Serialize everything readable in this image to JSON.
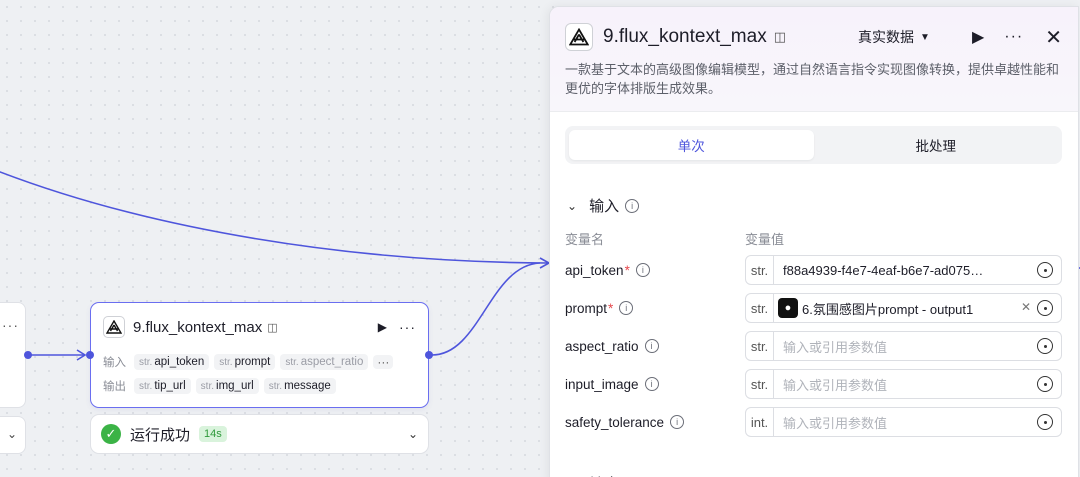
{
  "node": {
    "title": "9.flux_kontext_max",
    "input_label": "输入",
    "output_label": "输出",
    "inputs": [
      {
        "type": "str.",
        "name": "api_token"
      },
      {
        "type": "str.",
        "name": "prompt"
      },
      {
        "type": "str.",
        "name": "aspect_ratio"
      }
    ],
    "outputs": [
      {
        "type": "str.",
        "name": "tip_url"
      },
      {
        "type": "str.",
        "name": "img_url"
      },
      {
        "type": "str.",
        "name": "message"
      }
    ]
  },
  "status": {
    "text": "运行成功",
    "time": "14s"
  },
  "panel": {
    "title": "9.flux_kontext_max",
    "data_mode": "真实数据",
    "description": "一款基于文本的高级图像编辑模型，通过自然语言指令实现图像转换，提供卓越性能和更优的字体排版生成效果。",
    "tabs": [
      {
        "label": "单次",
        "active": true
      },
      {
        "label": "批处理",
        "active": false
      }
    ],
    "input_section": "输入",
    "col_name": "变量名",
    "col_value": "变量值",
    "params": [
      {
        "name": "api_token",
        "required": true,
        "type": "str.",
        "value": "f88a4939-f4e7-4eaf-b6e7-ad075…",
        "placeholder": ""
      },
      {
        "name": "prompt",
        "required": true,
        "type": "str.",
        "ref_node": "6.氛围感图片prompt",
        "ref_sep": " - ",
        "ref_output": "output1"
      },
      {
        "name": "aspect_ratio",
        "required": false,
        "type": "str.",
        "value": "",
        "placeholder": "输入或引用参数值"
      },
      {
        "name": "input_image",
        "required": false,
        "type": "str.",
        "value": "",
        "placeholder": "输入或引用参数值"
      },
      {
        "name": "safety_tolerance",
        "required": false,
        "type": "int.",
        "value": "",
        "placeholder": "输入或引用参数值"
      }
    ],
    "output_section": "输出"
  },
  "colors": {
    "accent": "#4e55dc",
    "success": "#3bb346",
    "required": "#e5484d"
  },
  "icons": [
    "flux-logo-icon",
    "robot-icon",
    "play-icon",
    "more-icon",
    "close-icon",
    "chevron-down-icon",
    "info-icon",
    "variable-icon",
    "check-circle-icon"
  ]
}
